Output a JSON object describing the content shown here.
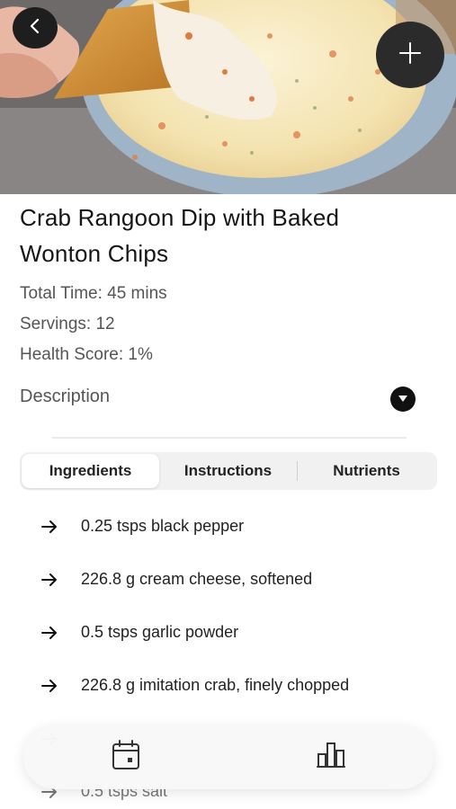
{
  "recipe": {
    "title": "Crab Rangoon Dip with Baked Wonton Chips",
    "total_time": "Total Time: 45 mins",
    "servings": "Servings: 12",
    "health_score": "Health Score: 1%",
    "description_label": "Description"
  },
  "tabs": [
    {
      "label": "Ingredients",
      "active": true
    },
    {
      "label": "Instructions",
      "active": false
    },
    {
      "label": "Nutrients",
      "active": false
    }
  ],
  "ingredients": [
    "0.25 tsps black pepper",
    "226.8 g cream cheese, softened",
    "0.5 tsps garlic powder",
    "226.8 g imitation crab, finely chopped",
    "",
    "0.5 tsps salt"
  ],
  "icons": {
    "back": "chevron-left-icon",
    "add": "plus-icon",
    "description_toggle": "caret-down-icon",
    "ingredient_bullet": "arrow-right-icon",
    "nav_calendar": "calendar-icon",
    "nav_chart": "bar-chart-icon"
  },
  "colors": {
    "accent_dark": "#1e1e1e",
    "text_primary": "#151515",
    "text_secondary": "#555555",
    "tab_background": "#f1f1f1"
  }
}
